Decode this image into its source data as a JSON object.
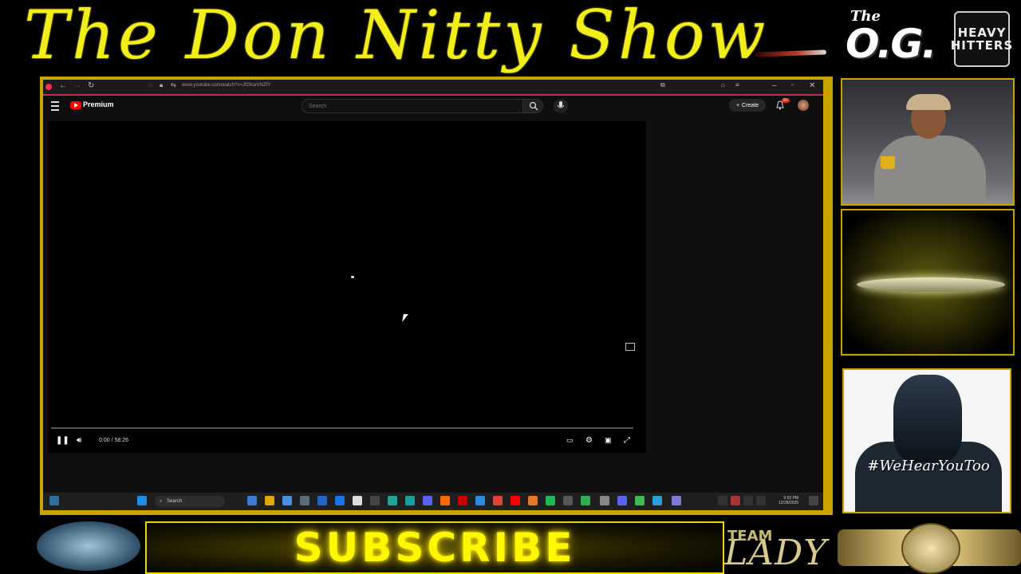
{
  "overlay": {
    "show_title": "The Don Nitty Show",
    "og_the": "The",
    "og_main": "O.G.",
    "hh_line1": "HEAVY",
    "hh_line2": "HITTERS",
    "cam_tagline": "#WeHearYouToo",
    "subscribe": "SUBSCRIBE",
    "team": "TEAM",
    "lady": "LADY"
  },
  "browser": {
    "url": "www.youtube.com/watch?v=Jf29ceVNZfY",
    "brand": "Premium",
    "search_placeholder": "Search",
    "create_label": "Create",
    "notif_badge": "9+"
  },
  "player": {
    "time": "0:00 / 58:26"
  },
  "taskbar": {
    "search_label": "Search",
    "clock_time": "9:53 PM",
    "clock_date": "12/28/2025"
  },
  "colors": {
    "banner_yellow": "#f2ee1c",
    "frame_gold": "#c9a400",
    "yt_red": "#ff0000"
  }
}
